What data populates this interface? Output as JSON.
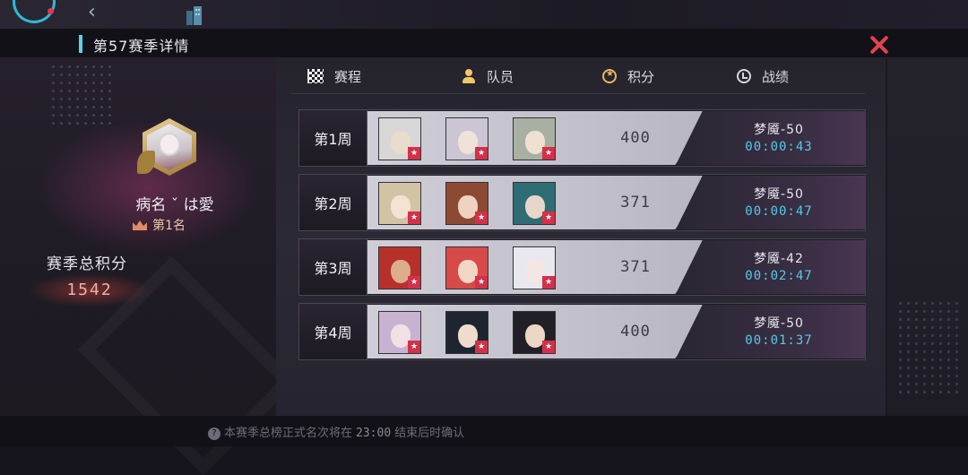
{
  "header": {
    "title": "第57赛季详情"
  },
  "player": {
    "name": "病名 ˇ は愛",
    "rank": "第1名"
  },
  "total": {
    "label": "赛季总积分",
    "value": "1542"
  },
  "tabs": [
    {
      "label": "赛程",
      "icon": "flag-icon"
    },
    {
      "label": "队员",
      "icon": "member-icon"
    },
    {
      "label": "积分",
      "icon": "medal-icon"
    },
    {
      "label": "战绩",
      "icon": "record-icon"
    }
  ],
  "weeks": [
    {
      "week": "第1周",
      "score": "400",
      "stage": "梦魇-50",
      "time": "00:00:43",
      "portraits": [
        {
          "hair": "#d9d6d8",
          "face": "#e9dccc"
        },
        {
          "hair": "#ccc6d4",
          "face": "#efe2d8"
        },
        {
          "hair": "#a8b0a4",
          "face": "#efe0d2"
        }
      ]
    },
    {
      "week": "第2周",
      "score": "371",
      "stage": "梦魇-50",
      "time": "00:00:47",
      "portraits": [
        {
          "hair": "#d2c3a5",
          "face": "#f2e3d2"
        },
        {
          "hair": "#8c4a34",
          "face": "#efd2bf"
        },
        {
          "hair": "#2f6d74",
          "face": "#e7d7ca"
        }
      ]
    },
    {
      "week": "第3周",
      "score": "371",
      "stage": "梦魇-42",
      "time": "00:02:47",
      "portraits": [
        {
          "hair": "#b8302a",
          "face": "#dcae8e"
        },
        {
          "hair": "#d64a48",
          "face": "#f1d6c6"
        },
        {
          "hair": "#e9e8ee",
          "face": "#f4e6e2"
        }
      ]
    },
    {
      "week": "第4周",
      "score": "400",
      "stage": "梦魇-50",
      "time": "00:01:37",
      "portraits": [
        {
          "hair": "#c7b2d2",
          "face": "#f2e0e4"
        },
        {
          "hair": "#1e2530",
          "face": "#efdccf"
        },
        {
          "hair": "#222026",
          "face": "#ecd6c6"
        }
      ]
    }
  ],
  "footer": {
    "pre": "本赛季总榜正式名次将在",
    "time": "23:00",
    "post": "结束后时确认"
  },
  "colors": {
    "accent_cyan": "#57c9e6",
    "close_red": "#e2424f",
    "score_glow": "#f2b0a6"
  }
}
